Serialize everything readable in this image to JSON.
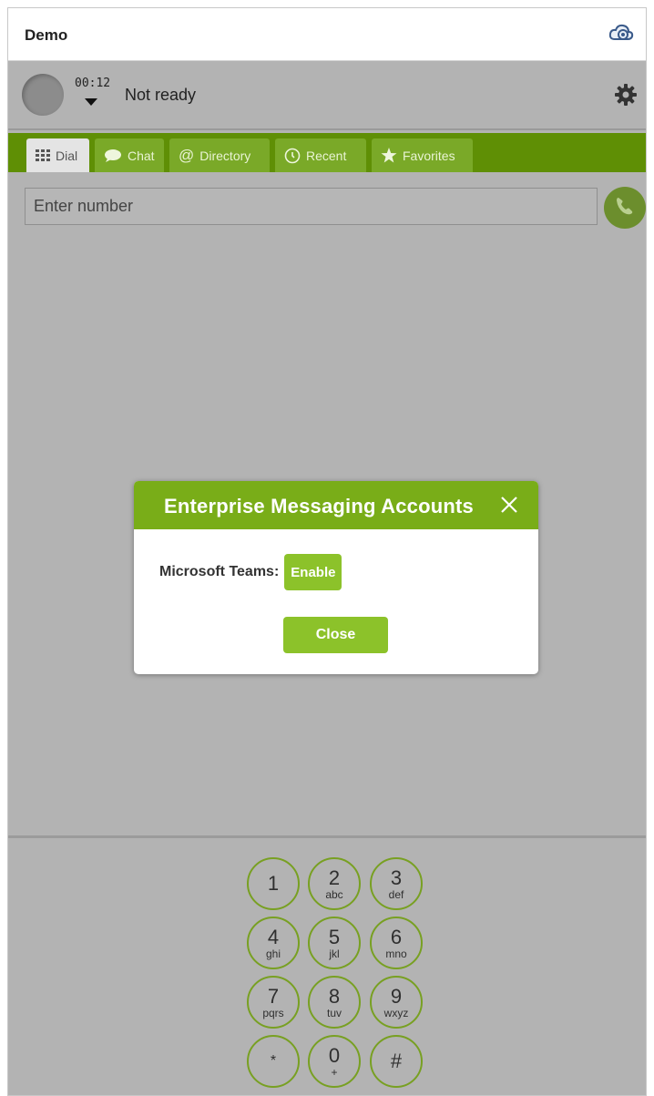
{
  "window": {
    "title": "Demo"
  },
  "status": {
    "timer": "00:12",
    "state": "Not ready"
  },
  "tabs": [
    {
      "label": "Dial",
      "icon": "grid-icon"
    },
    {
      "label": "Chat",
      "icon": "chat-icon"
    },
    {
      "label": "Directory",
      "icon": "at-icon"
    },
    {
      "label": "Recent",
      "icon": "clock-icon"
    },
    {
      "label": "Favorites",
      "icon": "star-icon"
    }
  ],
  "dial": {
    "placeholder": "Enter number"
  },
  "dialog": {
    "title": "Enterprise Messaging Accounts",
    "account_label": "Microsoft Teams:",
    "enable_label": "Enable",
    "close_label": "Close"
  },
  "keypad": [
    {
      "digit": "1",
      "letters": ""
    },
    {
      "digit": "2",
      "letters": "abc"
    },
    {
      "digit": "3",
      "letters": "def"
    },
    {
      "digit": "4",
      "letters": "ghi"
    },
    {
      "digit": "5",
      "letters": "jkl"
    },
    {
      "digit": "6",
      "letters": "mno"
    },
    {
      "digit": "7",
      "letters": "pqrs"
    },
    {
      "digit": "8",
      "letters": "tuv"
    },
    {
      "digit": "9",
      "letters": "wxyz"
    },
    {
      "digit": "*",
      "letters": ""
    },
    {
      "digit": "0",
      "letters": "+"
    },
    {
      "digit": "#",
      "letters": ""
    }
  ],
  "colors": {
    "brand_green": "#79ad18",
    "tab_bar": "#5f8f05",
    "button_green": "#8cc22a",
    "background": "#b3b3b3"
  }
}
